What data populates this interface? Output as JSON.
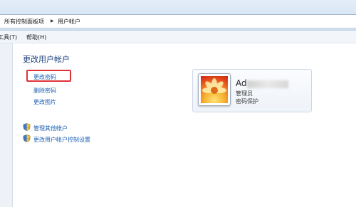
{
  "address_bar": {
    "crumbs": [
      "所有控制面板项",
      "用户帐户"
    ],
    "separator_icon": "triangle-right-icon"
  },
  "menu": {
    "tools": "工具(T)",
    "help": "帮助(H)"
  },
  "main": {
    "title": "更改用户帐户",
    "tasks": [
      "更改密码",
      "删除密码",
      "更改图片"
    ],
    "highlighted_task_index": 0,
    "highlight_color": "#e0323a",
    "security_links": [
      "管理其他帐户",
      "更改用户帐户控制设置"
    ],
    "security_icon": "uac-shield-icon"
  },
  "account": {
    "name_visible": "Ad",
    "role": "管理员",
    "password_status": "密码保护",
    "avatar_icon": "flower-avatar-icon"
  },
  "colors": {
    "link": "#1a5fb4",
    "title": "#1c3f7c"
  }
}
